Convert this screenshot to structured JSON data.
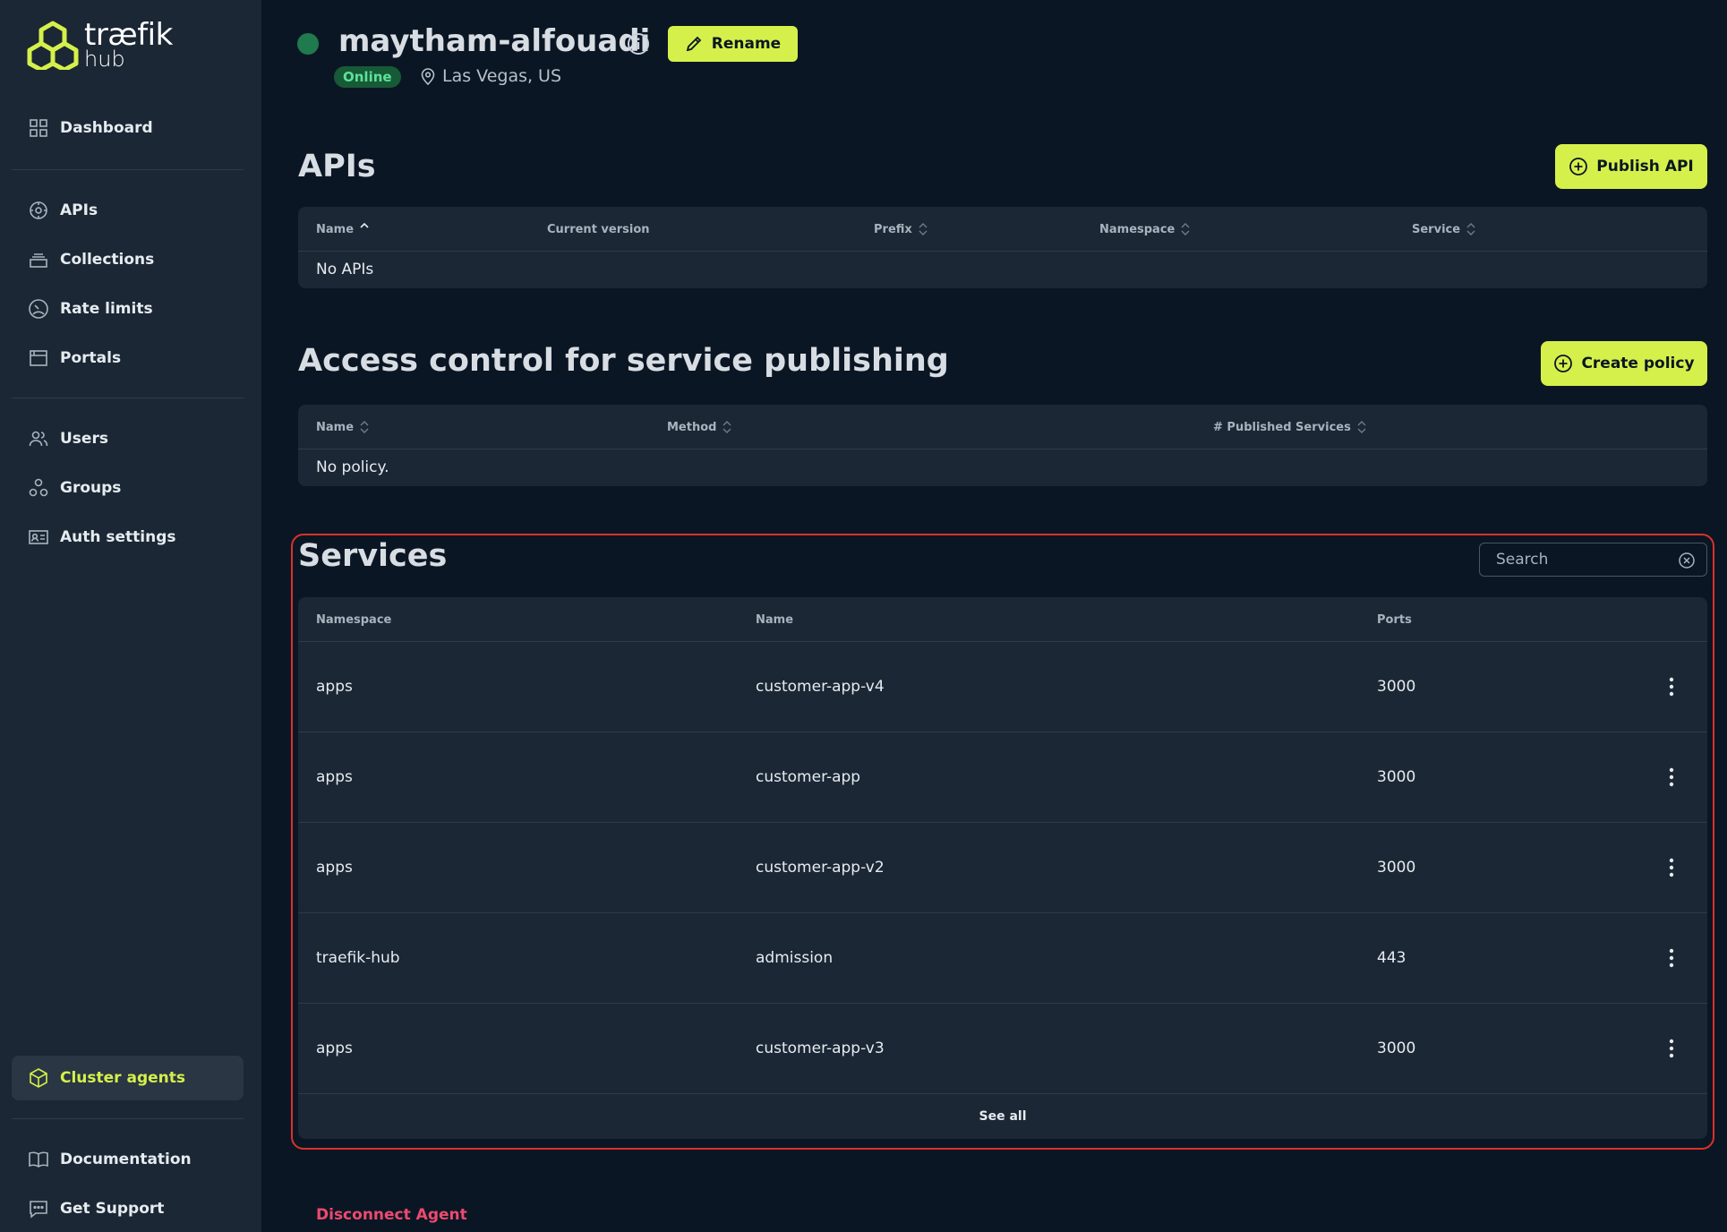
{
  "brand": {
    "name_line1": "træfik",
    "name_line2": "hub",
    "accent_color": "#d5f04a"
  },
  "sidebar": {
    "items": [
      {
        "label": "Dashboard",
        "icon": "grid-icon"
      },
      {
        "label": "APIs",
        "icon": "api-icon"
      },
      {
        "label": "Collections",
        "icon": "collections-icon"
      },
      {
        "label": "Rate limits",
        "icon": "gauge-icon"
      },
      {
        "label": "Portals",
        "icon": "portal-icon"
      },
      {
        "label": "Users",
        "icon": "users-icon"
      },
      {
        "label": "Groups",
        "icon": "groups-icon"
      },
      {
        "label": "Auth settings",
        "icon": "id-card-icon"
      },
      {
        "label": "Cluster agents",
        "icon": "cube-icon",
        "active": true
      },
      {
        "label": "Documentation",
        "icon": "book-icon"
      },
      {
        "label": "Get Support",
        "icon": "chat-icon"
      }
    ]
  },
  "agent": {
    "name": "maytham-alfouadi",
    "status": "Online",
    "location": "Las Vegas, US",
    "rename_label": "Rename"
  },
  "apis": {
    "title": "APIs",
    "publish_label": "Publish API",
    "columns": [
      "Name",
      "Current version",
      "Prefix",
      "Namespace",
      "Service"
    ],
    "empty": "No APIs"
  },
  "access": {
    "title": "Access control for service publishing",
    "create_label": "Create policy",
    "columns": [
      "Name",
      "Method",
      "# Published Services"
    ],
    "empty": "No policy."
  },
  "services": {
    "title": "Services",
    "search_placeholder": "Search",
    "columns": [
      "Namespace",
      "Name",
      "Ports"
    ],
    "rows": [
      {
        "namespace": "apps",
        "name": "customer-app-v4",
        "ports": "3000"
      },
      {
        "namespace": "apps",
        "name": "customer-app",
        "ports": "3000"
      },
      {
        "namespace": "apps",
        "name": "customer-app-v2",
        "ports": "3000"
      },
      {
        "namespace": "traefik-hub",
        "name": "admission",
        "ports": "443"
      },
      {
        "namespace": "apps",
        "name": "customer-app-v3",
        "ports": "3000"
      }
    ],
    "see_all": "See all"
  },
  "disconnect_label": "Disconnect Agent"
}
